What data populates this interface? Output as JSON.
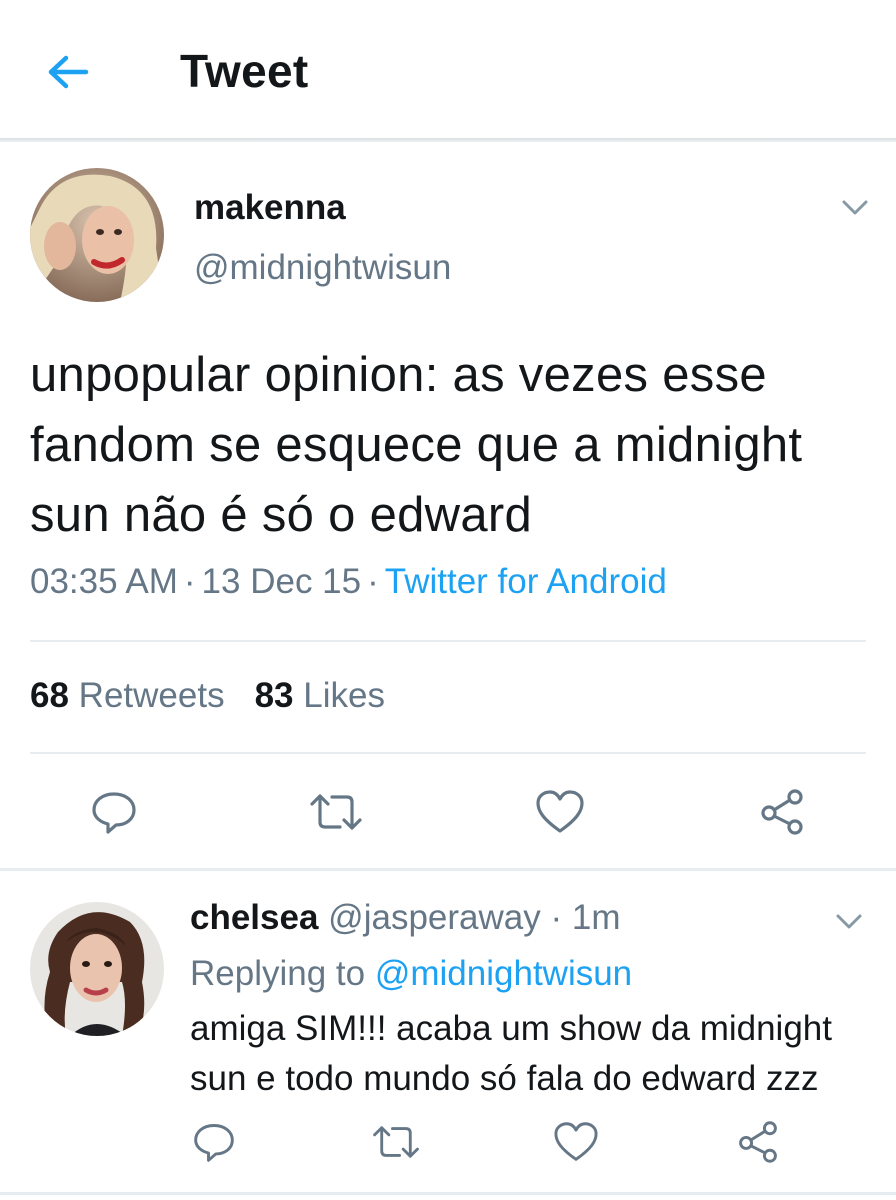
{
  "header": {
    "title": "Tweet"
  },
  "tweet": {
    "display_name": "makenna",
    "handle": "@midnightwisun",
    "text": "unpopular opinion: as vezes esse fandom se esquece que a midnight sun não é só o edward",
    "time": "03:35 AM",
    "date": "13 Dec 15",
    "source": "Twitter for Android",
    "retweets_count": "68",
    "retweets_label": "Retweets",
    "likes_count": "83",
    "likes_label": "Likes"
  },
  "reply": {
    "display_name": "chelsea",
    "handle": "@jasperaway",
    "age": "1m",
    "replying_to_label": "Replying to",
    "replying_to_handle": "@midnightwisun",
    "text": "amiga SIM!!! acaba um show da midnight sun e todo mundo só fala do edward zzz"
  },
  "icons": {
    "back": "arrow-left-icon",
    "caret": "chevron-down-icon",
    "reply": "reply-bubble-icon",
    "retweet": "retweet-icon",
    "like": "heart-icon",
    "share": "share-icon"
  },
  "colors": {
    "accent": "#1da1f2",
    "secondary_text": "#657786",
    "primary_text": "#14171a",
    "icon_gray": "#657786"
  }
}
